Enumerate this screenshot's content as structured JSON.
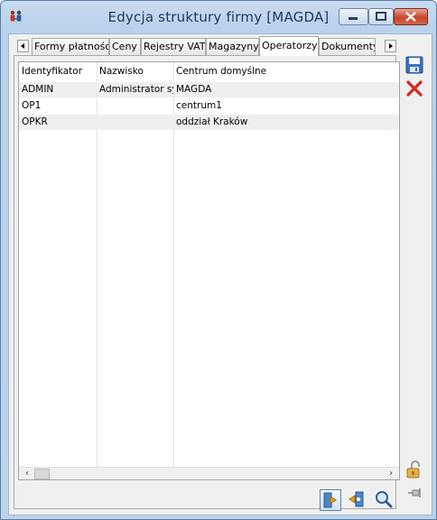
{
  "window": {
    "title": "Edycja struktury firmy [MAGDA]"
  },
  "tabs": [
    {
      "label": "Formy płatności",
      "active": false
    },
    {
      "label": "Ceny",
      "active": false
    },
    {
      "label": "Rejestry VAT",
      "active": false
    },
    {
      "label": "Magazyny",
      "active": false
    },
    {
      "label": "Operatorzy",
      "active": true
    },
    {
      "label": "Dokumenty",
      "active": false
    }
  ],
  "grid": {
    "columns": [
      "Identyfikator",
      "Nazwisko",
      "Centrum domyślne"
    ],
    "rows": [
      [
        "ADMIN",
        "Administrator sys",
        "MAGDA"
      ],
      [
        "OP1",
        "",
        "centrum1"
      ],
      [
        "OPKR",
        "",
        "oddział Kraków"
      ]
    ]
  },
  "icons": {
    "app": "org-structure-icon",
    "save": "floppy-disk-icon",
    "delete": "red-x-icon",
    "lock": "padlock-open-icon",
    "pin": "pin-icon",
    "attach": "attach-operator-icon",
    "detach": "detach-operator-icon",
    "preview": "magnifier-icon"
  },
  "colors": {
    "title_text": "#1e395b",
    "close_button": "#c7452b",
    "save_icon": "#3b6fc2",
    "delete_icon": "#d8241c"
  }
}
